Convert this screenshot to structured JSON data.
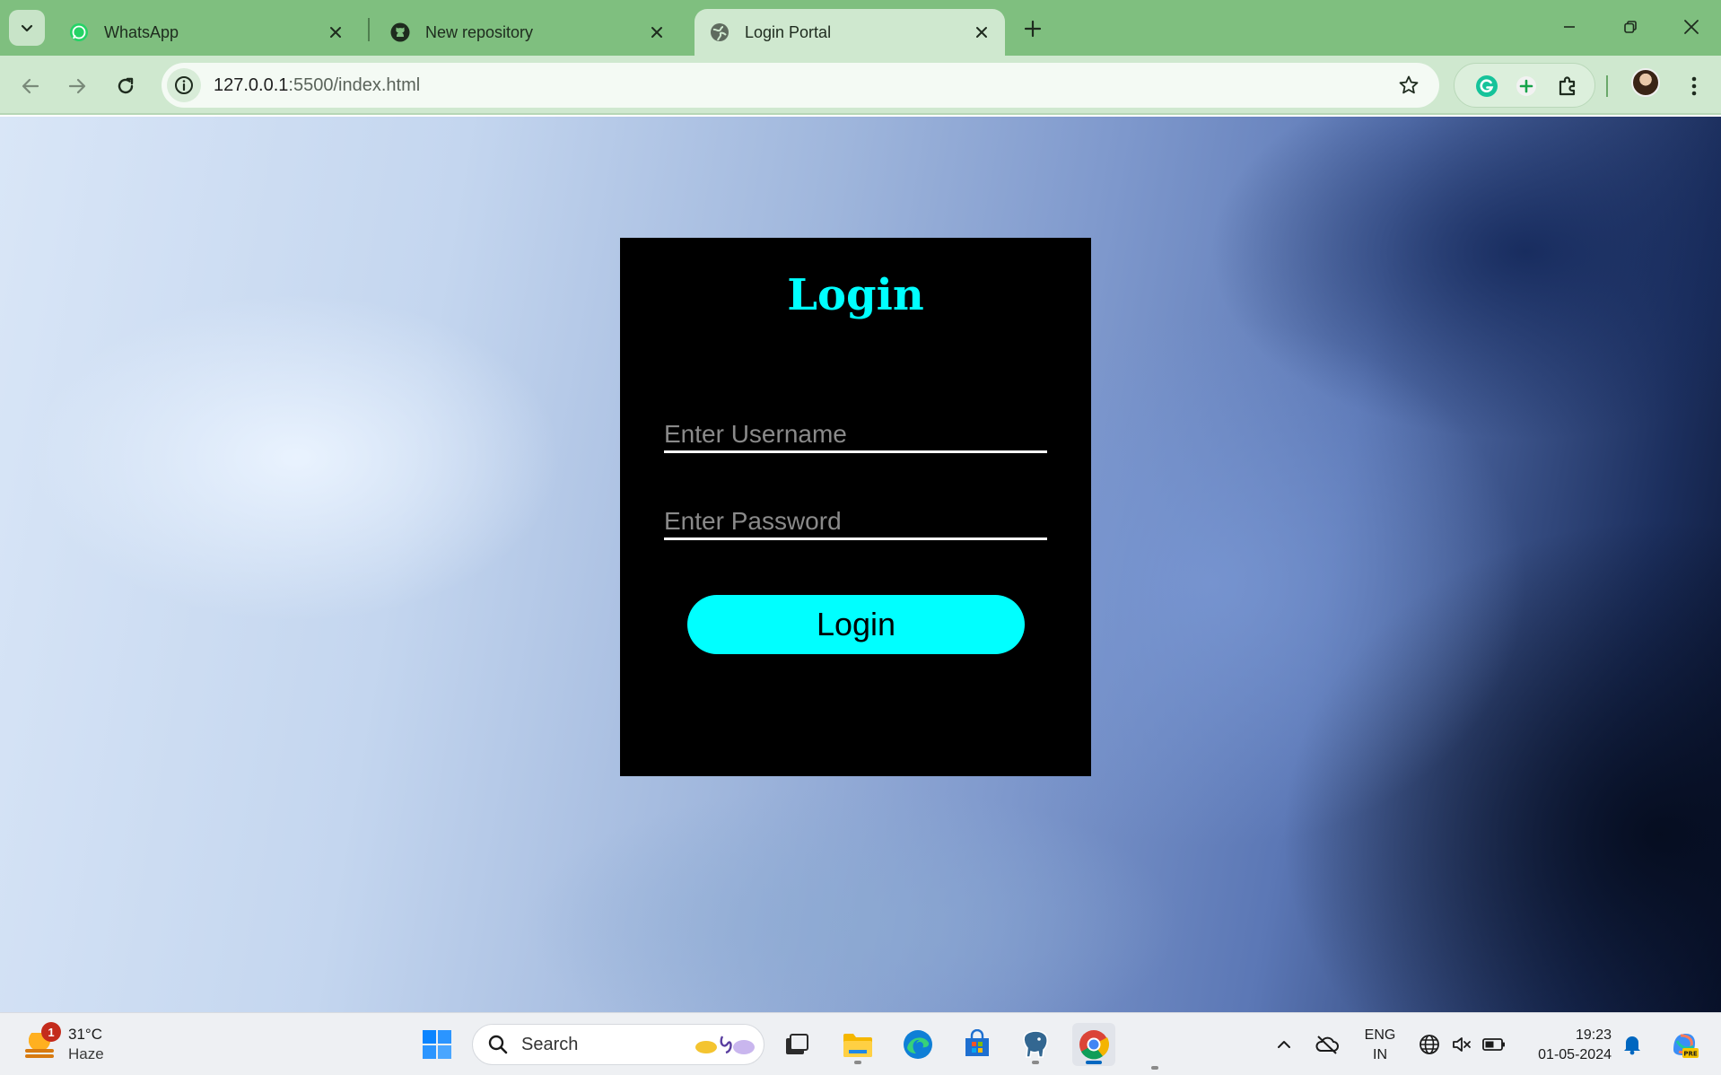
{
  "browser": {
    "tabs": [
      {
        "title": "WhatsApp",
        "icon": "whatsapp-icon",
        "active": false
      },
      {
        "title": "New repository",
        "icon": "github-icon",
        "active": false
      },
      {
        "title": "Login Portal",
        "icon": "globe-icon",
        "active": true
      }
    ],
    "address": {
      "host": "127.0.0.1",
      "rest": ":5500/index.html"
    },
    "accent_color": "#7fbf7f"
  },
  "page": {
    "title": "Login",
    "username_placeholder": "Enter Username",
    "password_placeholder": "Enter Password",
    "login_button": "Login",
    "accent_color": "#00ffff",
    "card_color": "#000000"
  },
  "taskbar": {
    "weather": {
      "badge": "1",
      "temp": "31°C",
      "condition": "Haze"
    },
    "search_label": "Search",
    "language": {
      "line1": "ENG",
      "line2": "IN"
    },
    "clock": {
      "time": "19:23",
      "date": "01-05-2024"
    }
  }
}
